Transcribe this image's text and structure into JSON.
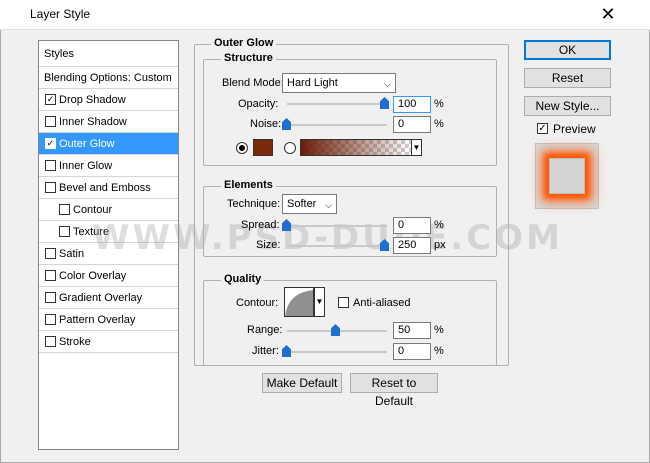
{
  "window": {
    "title": "Layer Style"
  },
  "styles_panel": {
    "header": "Styles",
    "blending_options": "Blending Options: Custom",
    "items": [
      {
        "label": "Drop Shadow",
        "checked": true
      },
      {
        "label": "Inner Shadow",
        "checked": false
      },
      {
        "label": "Outer Glow",
        "checked": true,
        "selected": true
      },
      {
        "label": "Inner Glow",
        "checked": false
      },
      {
        "label": "Bevel and Emboss",
        "checked": false
      },
      {
        "label": "Contour",
        "checked": false,
        "sub": true
      },
      {
        "label": "Texture",
        "checked": false,
        "sub": true
      },
      {
        "label": "Satin",
        "checked": false
      },
      {
        "label": "Color Overlay",
        "checked": false
      },
      {
        "label": "Gradient Overlay",
        "checked": false
      },
      {
        "label": "Pattern Overlay",
        "checked": false
      },
      {
        "label": "Stroke",
        "checked": false
      }
    ]
  },
  "outer_glow": {
    "section_title": "Outer Glow",
    "structure": {
      "title": "Structure",
      "blend_mode_label": "Blend Mode:",
      "blend_mode_value": "Hard Light",
      "opacity_label": "Opacity:",
      "opacity_value": "100",
      "opacity_level": 100,
      "noise_label": "Noise:",
      "noise_value": "0",
      "noise_level": 0,
      "percent": "%",
      "glow_color": "#7a2a0a",
      "color_mode": "solid"
    },
    "elements": {
      "title": "Elements",
      "technique_label": "Technique:",
      "technique_value": "Softer",
      "spread_label": "Spread:",
      "spread_value": "0",
      "spread_level": 0,
      "size_label": "Size:",
      "size_value": "250",
      "size_unit": "px",
      "percent": "%"
    },
    "quality": {
      "title": "Quality",
      "contour_label": "Contour:",
      "anti_aliased_label": "Anti-aliased",
      "anti_aliased": false,
      "range_label": "Range:",
      "range_value": "50",
      "range_level": 50,
      "jitter_label": "Jitter:",
      "jitter_value": "0",
      "jitter_level": 0,
      "percent": "%"
    },
    "make_default": "Make Default",
    "reset_to_default": "Reset to Default"
  },
  "actions": {
    "ok": "OK",
    "reset": "Reset",
    "new_style": "New Style...",
    "preview_label": "Preview",
    "preview_checked": true
  },
  "watermark": "WWW.PSD-DUDE.COM"
}
